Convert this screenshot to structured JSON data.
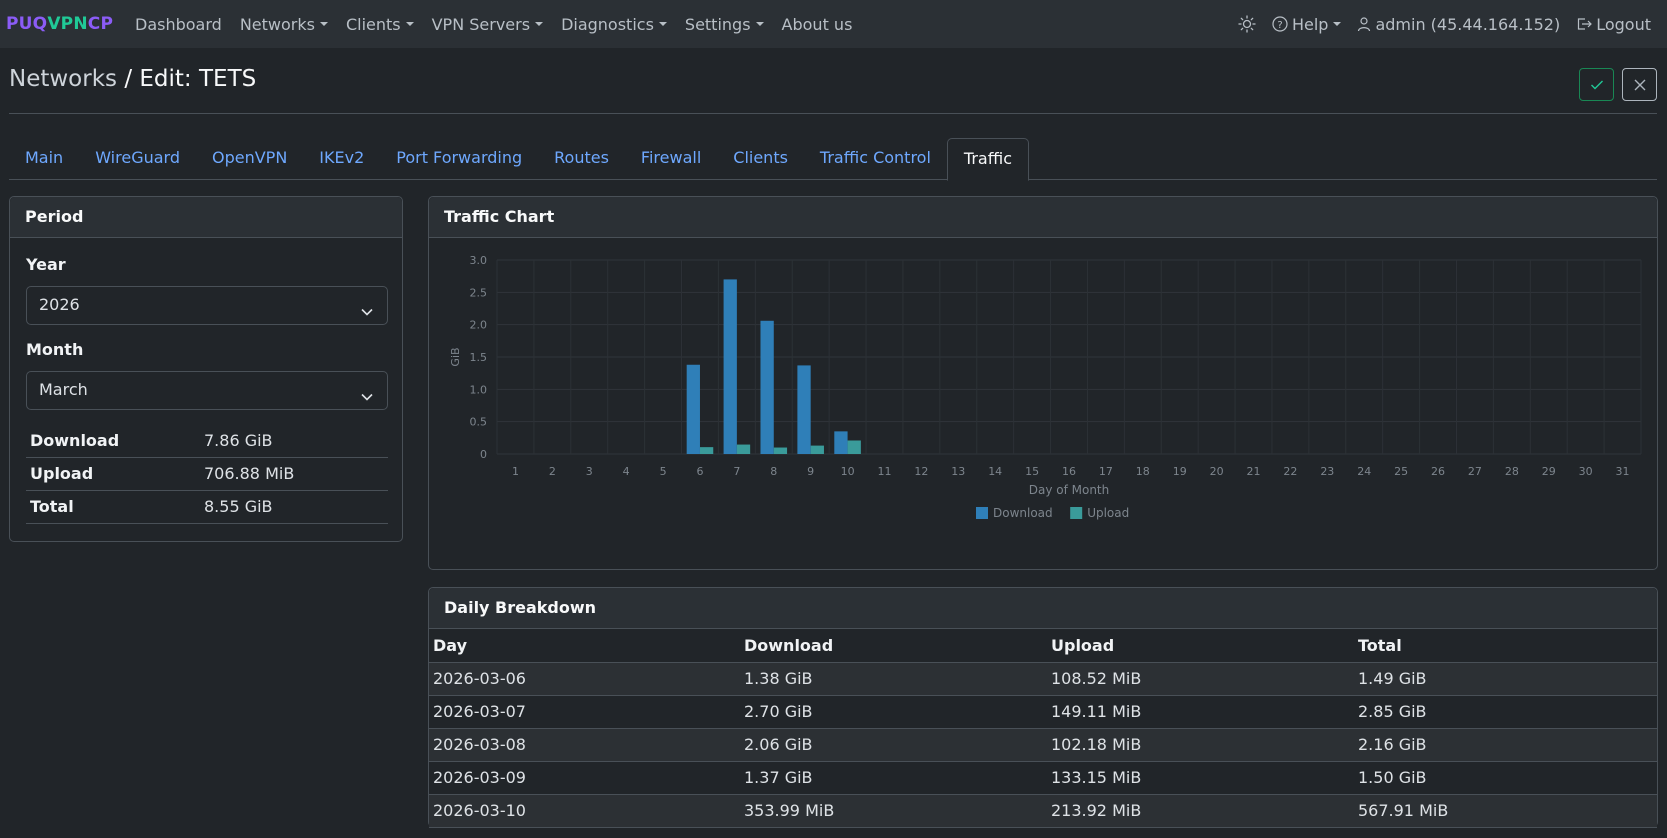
{
  "navbar": {
    "brand_parts": [
      "PUQ",
      "VPN",
      "CP"
    ],
    "items": [
      {
        "label": "Dashboard",
        "dropdown": false
      },
      {
        "label": "Networks",
        "dropdown": true
      },
      {
        "label": "Clients",
        "dropdown": true
      },
      {
        "label": "VPN Servers",
        "dropdown": true
      },
      {
        "label": "Diagnostics",
        "dropdown": true
      },
      {
        "label": "Settings",
        "dropdown": true
      },
      {
        "label": "About us",
        "dropdown": false
      }
    ],
    "theme_icon": "sun-icon",
    "help_label": "Help",
    "user_label": "admin (45.44.164.152)",
    "logout_label": "Logout"
  },
  "page": {
    "breadcrumb": "Networks",
    "title": "/ Edit: TETS"
  },
  "tabs": [
    "Main",
    "WireGuard",
    "OpenVPN",
    "IKEv2",
    "Port Forwarding",
    "Routes",
    "Firewall",
    "Clients",
    "Traffic Control",
    "Traffic"
  ],
  "active_tab": "Traffic",
  "period": {
    "header": "Period",
    "year_label": "Year",
    "year_value": "2026",
    "month_label": "Month",
    "month_value": "March",
    "summary": [
      {
        "key": "Download",
        "value": "7.86 GiB"
      },
      {
        "key": "Upload",
        "value": "706.88 MiB"
      },
      {
        "key": "Total",
        "value": "8.55 GiB"
      }
    ]
  },
  "chart_card": {
    "header": "Traffic Chart"
  },
  "chart_data": {
    "type": "bar",
    "categories": [
      "1",
      "2",
      "3",
      "4",
      "5",
      "6",
      "7",
      "8",
      "9",
      "10",
      "11",
      "12",
      "13",
      "14",
      "15",
      "16",
      "17",
      "18",
      "19",
      "20",
      "21",
      "22",
      "23",
      "24",
      "25",
      "26",
      "27",
      "28",
      "29",
      "30",
      "31"
    ],
    "series": [
      {
        "name": "Download",
        "color": "#2f7fb8",
        "values": [
          0,
          0,
          0,
          0,
          0,
          1.38,
          2.7,
          2.06,
          1.37,
          0.35,
          0,
          0,
          0,
          0,
          0,
          0,
          0,
          0,
          0,
          0,
          0,
          0,
          0,
          0,
          0,
          0,
          0,
          0,
          0,
          0,
          0
        ]
      },
      {
        "name": "Upload",
        "color": "#3a9b9a",
        "values": [
          0,
          0,
          0,
          0,
          0,
          0.106,
          0.146,
          0.1,
          0.13,
          0.209,
          0,
          0,
          0,
          0,
          0,
          0,
          0,
          0,
          0,
          0,
          0,
          0,
          0,
          0,
          0,
          0,
          0,
          0,
          0,
          0,
          0
        ]
      }
    ],
    "yticks": [
      "0",
      "0.5",
      "1.0",
      "1.5",
      "2.0",
      "2.5",
      "3.0"
    ],
    "xlabel": "Day of Month",
    "ylabel": "GiB",
    "ylim": [
      0,
      3.0
    ],
    "legend_position": "bottom-center"
  },
  "daily": {
    "header": "Daily Breakdown",
    "columns": [
      "Day",
      "Download",
      "Upload",
      "Total"
    ],
    "rows": [
      [
        "2026-03-06",
        "1.38 GiB",
        "108.52 MiB",
        "1.49 GiB"
      ],
      [
        "2026-03-07",
        "2.70 GiB",
        "149.11 MiB",
        "2.85 GiB"
      ],
      [
        "2026-03-08",
        "2.06 GiB",
        "102.18 MiB",
        "2.16 GiB"
      ],
      [
        "2026-03-09",
        "1.37 GiB",
        "133.15 MiB",
        "1.50 GiB"
      ],
      [
        "2026-03-10",
        "353.99 MiB",
        "213.92 MiB",
        "567.91 MiB"
      ]
    ]
  }
}
